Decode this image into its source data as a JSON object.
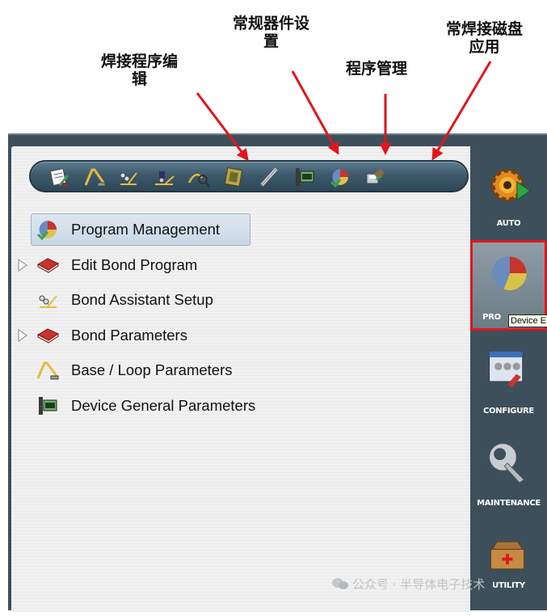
{
  "annotations": {
    "weld_program_edit": "焊接程序编\n辑",
    "general_device_settings": "常规器件设\n置",
    "program_management": "程序管理",
    "common_bond_disk_app": "常焊接磁盘\n应用"
  },
  "toolbar": {
    "buttons": [
      {
        "icon": "edit-program-icon"
      },
      {
        "icon": "base-loop-icon"
      },
      {
        "icon": "bond-assistant-icon"
      },
      {
        "icon": "bond-setup-icon"
      },
      {
        "icon": "loop-search-icon"
      },
      {
        "icon": "chip-device-icon"
      },
      {
        "icon": "wire-icon"
      },
      {
        "icon": "device-general-icon"
      },
      {
        "icon": "program-management-icon"
      },
      {
        "icon": "disk-application-icon"
      }
    ]
  },
  "tree": {
    "items": [
      {
        "label": "Program Management",
        "icon": "program-management-icon",
        "selected": true,
        "expandable": false
      },
      {
        "label": "Edit Bond Program",
        "icon": "red-book-icon",
        "selected": false,
        "expandable": true
      },
      {
        "label": "Bond Assistant Setup",
        "icon": "bond-assistant-icon",
        "selected": false,
        "expandable": false
      },
      {
        "label": "Bond Parameters",
        "icon": "red-book-icon",
        "selected": false,
        "expandable": true
      },
      {
        "label": "Base / Loop Parameters",
        "icon": "base-loop-icon",
        "selected": false,
        "expandable": false
      },
      {
        "label": "Device General Parameters",
        "icon": "device-general-icon",
        "selected": false,
        "expandable": false
      }
    ]
  },
  "sidebar": {
    "auto_label": "AUTO",
    "program_label": "PRO",
    "configure_label": "CONFIGURE",
    "maintenance_label": "MAINTENANCE",
    "utility_label": "UTILITY",
    "tooltip": "Device E"
  },
  "watermark": "公众号 · 半导体电子技术",
  "colors": {
    "arrow": "#e0161c",
    "panel": "#3c4f5b",
    "selection": "#c9d7e6",
    "active_border": "#e0161c"
  }
}
